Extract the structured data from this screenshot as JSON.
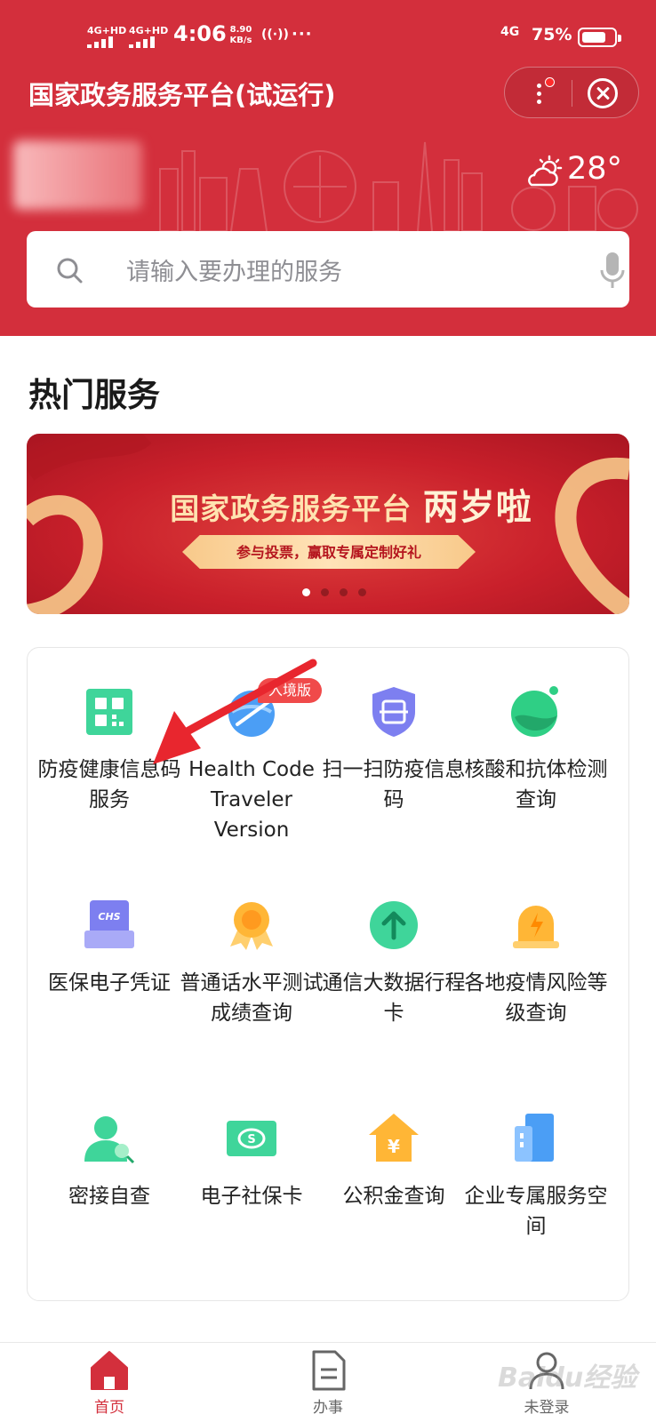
{
  "status_bar": {
    "sim1": "4G+HD",
    "sim2": "4G+HD",
    "time": "4:06",
    "speed_value": "8.90",
    "speed_unit": "KB/s",
    "network": "4G",
    "battery": "75%",
    "battery_level": 0.75
  },
  "header": {
    "title": "国家政务服务平台(试运行)",
    "temperature": "28°"
  },
  "search": {
    "placeholder": "请输入要办理的服务"
  },
  "hot_services": {
    "title": "热门服务"
  },
  "banner": {
    "title_a": "国家政务服务平台",
    "title_b": "两岁啦",
    "subtitle": "参与投票，赢取专属定制好礼",
    "pages": 4,
    "active_page": 1
  },
  "services": [
    {
      "label": "防疫健康信息码服务",
      "icon": "qr-code-icon"
    },
    {
      "label": "Health Code Traveler Version",
      "icon": "globe-plane-icon",
      "badge": "入境版"
    },
    {
      "label": "扫一扫防疫信息码",
      "icon": "shield-scan-icon"
    },
    {
      "label": "核酸和抗体检测查询",
      "icon": "flask-icon"
    },
    {
      "label": "医保电子凭证",
      "icon": "chs-card-icon"
    },
    {
      "label": "普通话水平测试成绩查询",
      "icon": "medal-icon"
    },
    {
      "label": "通信大数据行程卡",
      "icon": "arrow-up-circle-icon"
    },
    {
      "label": "各地疫情风险等级查询",
      "icon": "alarm-light-icon"
    },
    {
      "label": "密接自查",
      "icon": "person-search-icon"
    },
    {
      "label": "电子社保卡",
      "icon": "social-security-card-icon"
    },
    {
      "label": "公积金查询",
      "icon": "house-yuan-icon"
    },
    {
      "label": "企业专属服务空间",
      "icon": "building-icon"
    }
  ],
  "tabbar": {
    "tabs": [
      {
        "label": "首页",
        "icon": "home-icon",
        "active": true
      },
      {
        "label": "办事",
        "icon": "document-icon",
        "active": false
      },
      {
        "label": "未登录",
        "icon": "user-icon",
        "active": false
      }
    ]
  },
  "watermark": "Baidu经验",
  "colors": {
    "brand_red": "#d32f3c",
    "active_tab": "#d32f3c"
  }
}
